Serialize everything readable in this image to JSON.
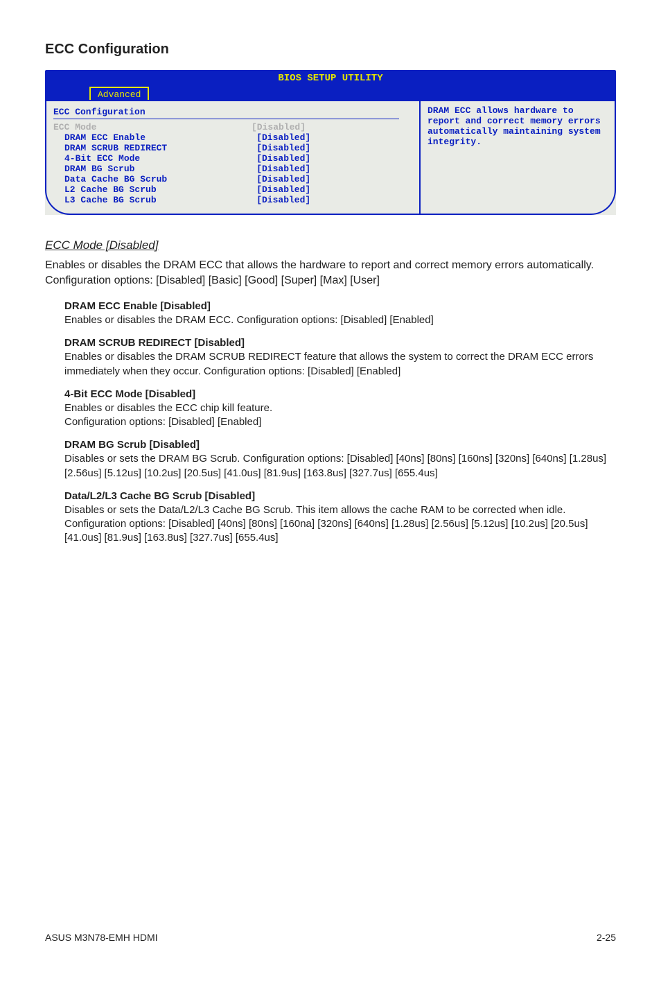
{
  "section_title": "ECC Configuration",
  "bios": {
    "utility_title": "BIOS SETUP UTILITY",
    "tab": "Advanced",
    "panel_heading": "ECC Configuration",
    "rows": [
      {
        "label": "ECC Mode",
        "value": "[Disabled]",
        "sel": true,
        "indent": false
      },
      {
        "label": "DRAM ECC Enable",
        "value": "[Disabled]",
        "sel": false,
        "indent": true
      },
      {
        "label": "DRAM SCRUB REDIRECT",
        "value": "[Disabled]",
        "sel": false,
        "indent": true
      },
      {
        "label": "4-Bit ECC Mode",
        "value": "[Disabled]",
        "sel": false,
        "indent": true
      },
      {
        "label": "DRAM BG Scrub",
        "value": "[Disabled]",
        "sel": false,
        "indent": true
      },
      {
        "label": "Data Cache BG Scrub",
        "value": "[Disabled]",
        "sel": false,
        "indent": true
      },
      {
        "label": "L2 Cache BG Scrub",
        "value": "[Disabled]",
        "sel": false,
        "indent": true
      },
      {
        "label": "L3 Cache BG Scrub",
        "value": "[Disabled]",
        "sel": false,
        "indent": true
      }
    ],
    "help_text": "DRAM ECC allows hardware to report and correct memory errors automatically maintaining system integrity."
  },
  "para1": {
    "heading": "ECC Mode [Disabled]",
    "body": "Enables or disables the DRAM ECC that allows the hardware to report and correct memory errors automatically. Configuration options: [Disabled] [Basic] [Good] [Super] [Max] [User]"
  },
  "subitems": [
    {
      "title": "DRAM ECC Enable [Disabled]",
      "body": "Enables or disables the DRAM ECC. Configuration options: [Disabled] [Enabled]"
    },
    {
      "title": "DRAM SCRUB REDIRECT [Disabled]",
      "body": "Enables or disables the DRAM SCRUB REDIRECT feature that allows the system to correct the DRAM ECC errors immediately when they occur. Configuration options: [Disabled] [Enabled]"
    },
    {
      "title": "4-Bit ECC Mode [Disabled]",
      "body": "Enables or disables the ECC chip kill feature.\nConfiguration options: [Disabled] [Enabled]"
    },
    {
      "title": "DRAM BG Scrub [Disabled]",
      "body": "Disables or sets the DRAM BG Scrub. Configuration options: [Disabled] [40ns] [80ns] [160ns] [320ns] [640ns] [1.28us] [2.56us] [5.12us] [10.2us] [20.5us] [41.0us] [81.9us] [163.8us] [327.7us] [655.4us]"
    },
    {
      "title": "Data/L2/L3 Cache BG Scrub [Disabled]",
      "body": "Disables or sets the Data/L2/L3 Cache BG Scrub. This item allows the cache RAM to be corrected when idle. Configuration options: [Disabled] [40ns] [80ns] [160na] [320ns] [640ns] [1.28us] [2.56us] [5.12us] [10.2us] [20.5us] [41.0us] [81.9us] [163.8us] [327.7us] [655.4us]"
    }
  ],
  "footer": {
    "left": "ASUS M3N78-EMH HDMI",
    "right": "2-25"
  }
}
